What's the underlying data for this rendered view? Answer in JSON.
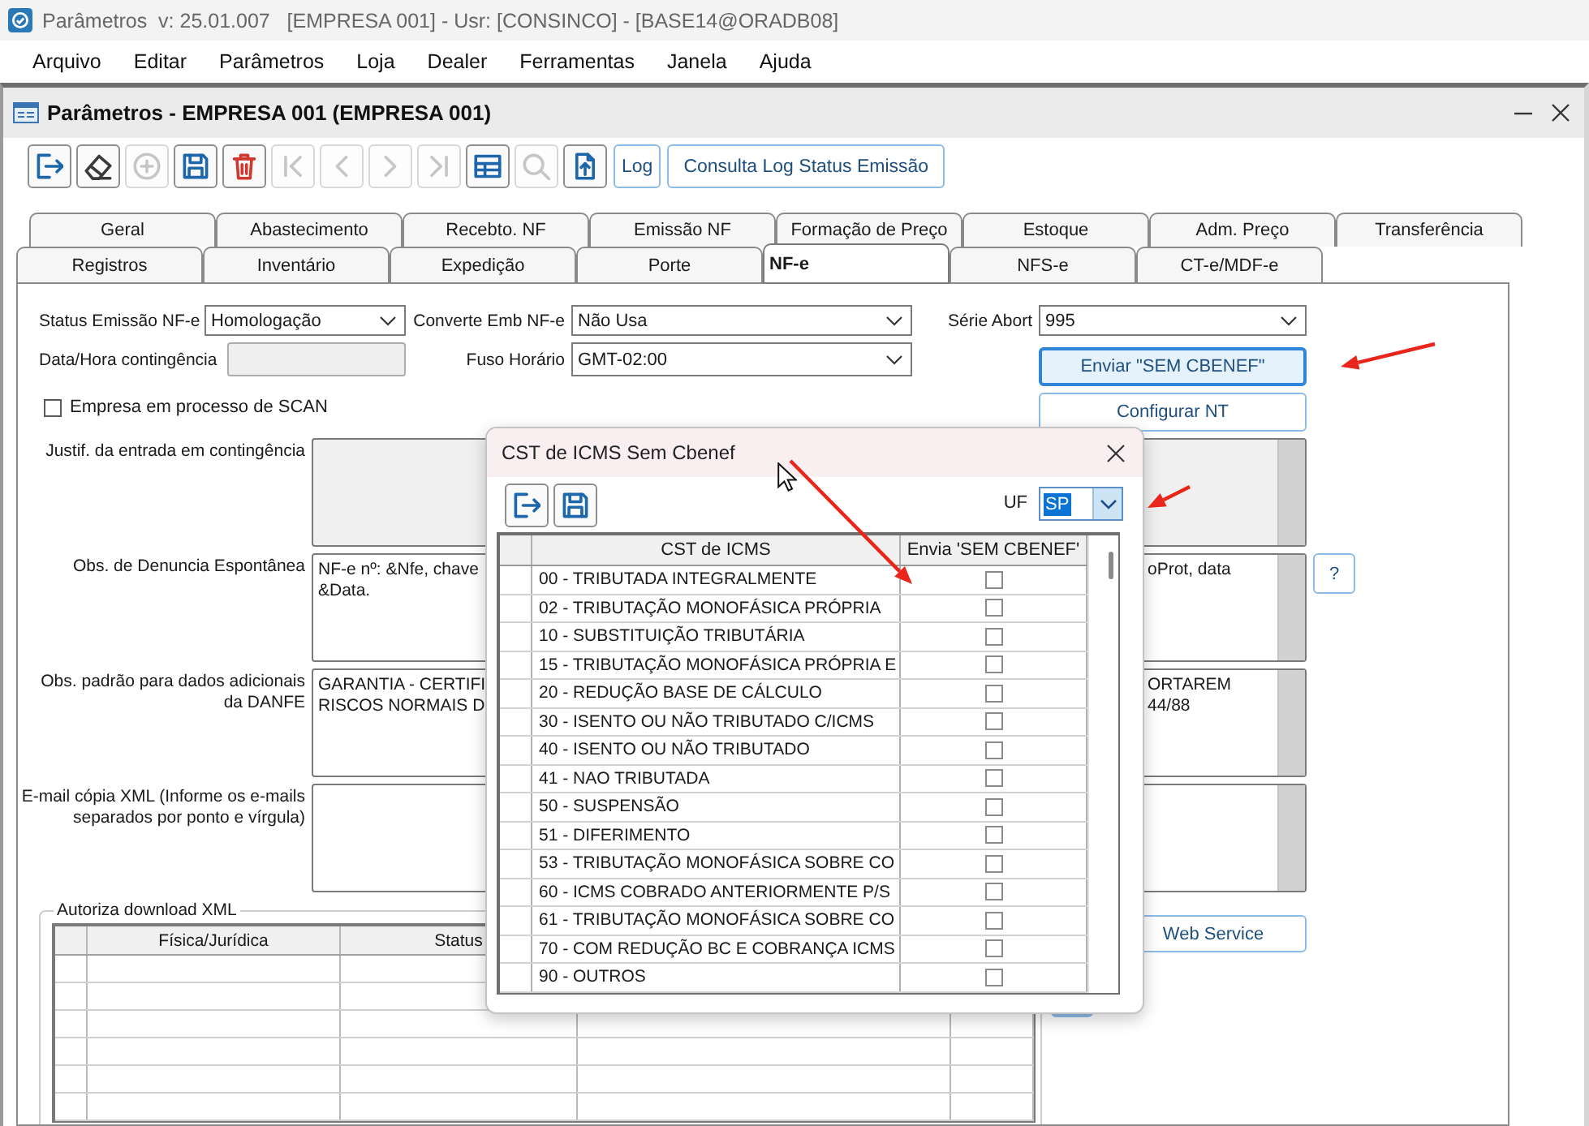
{
  "window": {
    "title": "Parâmetros  v: 25.01.007   [EMPRESA 001] - Usr: [CONSINCO] - [BASE14@ORADB08]"
  },
  "menu": [
    {
      "label": "Arquivo"
    },
    {
      "label": "Editar"
    },
    {
      "label": "Parâmetros"
    },
    {
      "label": "Loja"
    },
    {
      "label": "Dealer"
    },
    {
      "label": "Ferramentas"
    },
    {
      "label": "Janela"
    },
    {
      "label": "Ajuda"
    }
  ],
  "child_window": {
    "title": "Parâmetros - EMPRESA 001 (EMPRESA 001)"
  },
  "toolbar": {
    "icon_buttons": [
      {
        "disabled": false
      },
      {
        "disabled": false
      },
      {
        "disabled": true
      },
      {
        "disabled": false
      },
      {
        "disabled": false
      },
      {
        "disabled": true
      },
      {
        "disabled": true
      },
      {
        "disabled": true
      },
      {
        "disabled": true
      },
      {
        "disabled": false
      },
      {
        "disabled": true
      },
      {
        "disabled": false
      }
    ],
    "text_buttons": [
      {
        "label": "Log"
      },
      {
        "label": "Consulta Log Status Emissão"
      }
    ]
  },
  "tab_rows": [
    [
      {
        "label": "Geral",
        "selected": false
      },
      {
        "label": "Abastecimento",
        "selected": false
      },
      {
        "label": "Recebto. NF",
        "selected": false
      },
      {
        "label": "Emissão NF",
        "selected": false
      },
      {
        "label": "Formação de Preço",
        "selected": false
      },
      {
        "label": "Estoque",
        "selected": false
      },
      {
        "label": "Adm. Preço",
        "selected": false
      },
      {
        "label": "Transferência",
        "selected": false
      }
    ],
    [
      {
        "label": "Registros",
        "selected": false
      },
      {
        "label": "Inventário",
        "selected": false
      },
      {
        "label": "Expedição",
        "selected": false
      },
      {
        "label": "Porte",
        "selected": false
      },
      {
        "label": "NF-e",
        "selected": true
      },
      {
        "label": "NFS-e",
        "selected": false
      },
      {
        "label": "CT-e/MDF-e",
        "selected": false
      }
    ]
  ],
  "form": {
    "status_emissao": {
      "label": "Status Emissão NF-e",
      "value": "Homologação"
    },
    "converte_emb": {
      "label": "Converte Emb NF-e",
      "value": "Não Usa"
    },
    "serie_abort": {
      "label": "Série Abort",
      "value": "995"
    },
    "data_hora": {
      "label": "Data/Hora contingência",
      "disabled": true
    },
    "fuso_horario": {
      "label": "Fuso Horário",
      "value": "GMT-02:00"
    },
    "scan": {
      "label": "Empresa em processo de SCAN",
      "checked": false
    },
    "enviar_button": {
      "label": "Enviar \"SEM CBENEF\"",
      "focused": true
    },
    "configurar_button": {
      "label": "Configurar NT",
      "focused": false
    },
    "text_areas": [
      {
        "label": "Justif. da entrada em contingência",
        "disabled": true
      },
      {
        "label": "Obs. de Denuncia Espontânea",
        "disabled": false,
        "visible_left": "NF-e nº: &Nfe, chave\n&Data.",
        "visible_right": "oProt, data",
        "help_button": "?"
      },
      {
        "label": "Obs. padrão para dados adicionais\nda DANFE",
        "disabled": false,
        "visible_left": "GARANTIA - CERTIFI\nRISCOS NORMAIS D",
        "visible_right": "ORTAREM\n44/88"
      },
      {
        "label": "E-mail cópia XML (Informe os e-mails\nseparados por ponto e vírgula)",
        "disabled": false
      }
    ],
    "download_group": {
      "title": "Autoriza download XML",
      "columns": [
        {
          "label": "Física/Jurídica"
        },
        {
          "label": "Status"
        }
      ]
    },
    "web_service_button": {
      "label": "Web Service"
    }
  },
  "dialog": {
    "title": "CST de ICMS Sem Cbenef",
    "uf": {
      "label": "UF",
      "value": "SP",
      "focused": true
    },
    "grid": {
      "columns": [
        {
          "label": "CST de ICMS"
        },
        {
          "label": "Envia 'SEM CBENEF'"
        }
      ],
      "rows": [
        {
          "cst": "00 - TRIBUTADA INTEGRALMENTE",
          "checked": false
        },
        {
          "cst": "02 - TRIBUTAÇÃO MONOFÁSICA PRÓPRIA",
          "checked": false
        },
        {
          "cst": "10 - SUBSTITUIÇÃO TRIBUTÁRIA",
          "checked": false
        },
        {
          "cst": "15 - TRIBUTAÇÃO MONOFÁSICA PRÓPRIA E",
          "checked": false
        },
        {
          "cst": "20 - REDUÇÃO BASE DE CÁLCULO",
          "checked": false
        },
        {
          "cst": "30 - ISENTO OU NÃO TRIBUTADO C/ICMS",
          "checked": false
        },
        {
          "cst": "40 - ISENTO OU NÃO TRIBUTADO",
          "checked": false
        },
        {
          "cst": "41 - NAO TRIBUTADA",
          "checked": false
        },
        {
          "cst": "50 - SUSPENSÃO",
          "checked": false
        },
        {
          "cst": "51 - DIFERIMENTO",
          "checked": false
        },
        {
          "cst": "53 - TRIBUTAÇÃO MONOFÁSICA SOBRE CO",
          "checked": false
        },
        {
          "cst": "60 - ICMS COBRADO ANTERIORMENTE P/S",
          "checked": false
        },
        {
          "cst": "61 - TRIBUTAÇÃO MONOFÁSICA SOBRE CO",
          "checked": false
        },
        {
          "cst": "70 - COM REDUÇÃO BC E COBRANÇA ICMS",
          "checked": false
        },
        {
          "cst": "90 - OUTROS",
          "checked": false
        }
      ]
    }
  }
}
